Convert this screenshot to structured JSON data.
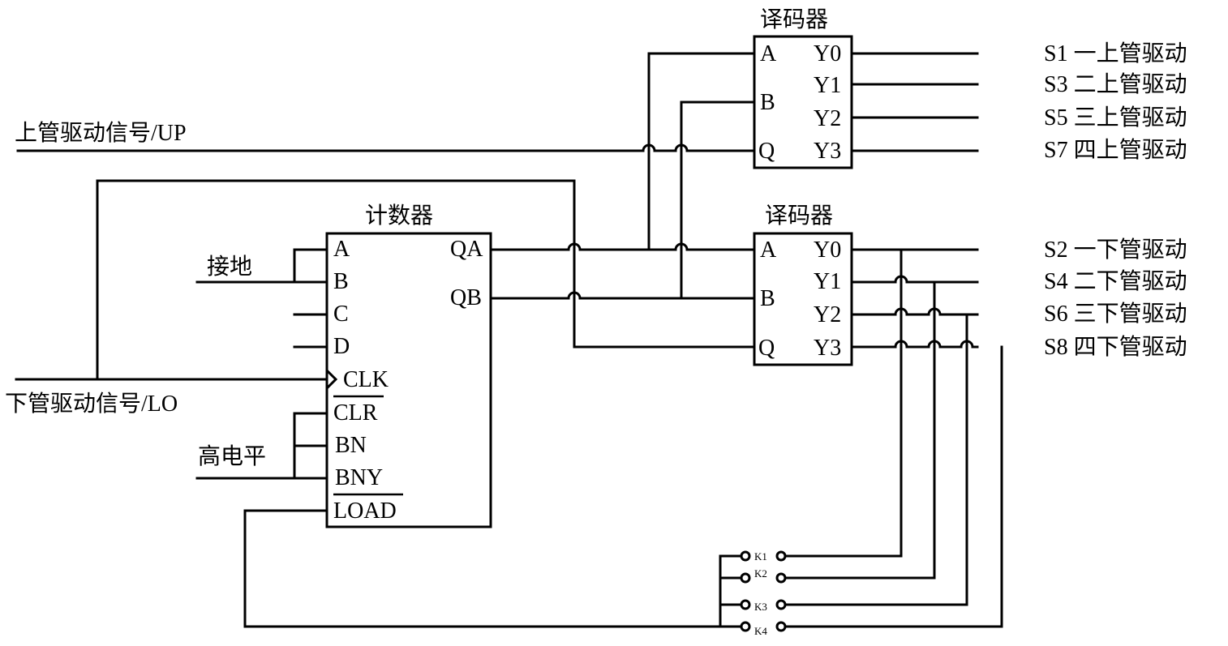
{
  "labels": {
    "up_signal": "上管驱动信号/UP",
    "lo_signal": "下管驱动信号/LO",
    "ground": "接地",
    "high_level": "高电平"
  },
  "counter": {
    "title": "计数器",
    "inputs": [
      "A",
      "B",
      "C",
      "D",
      "CLK",
      "CLR",
      "BN",
      "BNY",
      "LOAD"
    ],
    "outputs": [
      "QA",
      "QB"
    ]
  },
  "decoder_upper": {
    "title": "译码器",
    "inputs": [
      "A",
      "B",
      "Q"
    ],
    "outputs": [
      "Y0",
      "Y1",
      "Y2",
      "Y3"
    ]
  },
  "decoder_lower": {
    "title": "译码器",
    "inputs": [
      "A",
      "B",
      "Q"
    ],
    "outputs": [
      "Y0",
      "Y1",
      "Y2",
      "Y3"
    ]
  },
  "upper_outputs": [
    "S1 一上管驱动",
    "S3 二上管驱动",
    "S5 三上管驱动",
    "S7 四上管驱动"
  ],
  "lower_outputs": [
    "S2 一下管驱动",
    "S4 二下管驱动",
    "S6 三下管驱动",
    "S8 四下管驱动"
  ],
  "switches": [
    "K1",
    "K2",
    "K3",
    "K4"
  ]
}
